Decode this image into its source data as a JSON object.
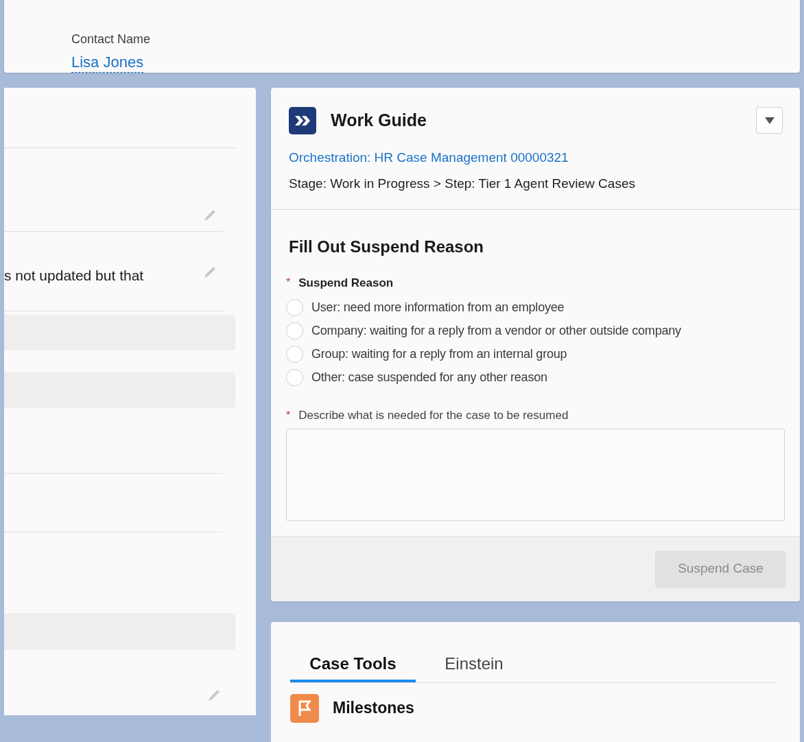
{
  "record_header": {
    "fields": [
      {
        "label": "Contact Name",
        "value": "Lisa Jones"
      }
    ]
  },
  "details_panel": {
    "partial_text": "s not updated but that"
  },
  "work_guide": {
    "title": "Work Guide",
    "orchestration_link": "Orchestration: HR Case Management 00000321",
    "stage": "Stage: Work in Progress > Step: Tier 1 Agent Review Cases",
    "form": {
      "title": "Fill Out Suspend Reason",
      "reason": {
        "label": "Suspend Reason",
        "required": true,
        "required_mark": "*",
        "options": [
          {
            "label": "User: need more information from an employee",
            "selected": false
          },
          {
            "label": "Company: waiting for a reply from a vendor or other outside company",
            "selected": false
          },
          {
            "label": "Group: waiting for a reply from an internal group",
            "selected": false
          },
          {
            "label": "Other: case suspended for any other reason",
            "selected": false
          }
        ]
      },
      "description": {
        "label": "Describe what is needed for the case to be resumed",
        "required": true,
        "required_mark": "*"
      }
    },
    "button": {
      "label": "Suspend Case",
      "disabled": true
    }
  },
  "case_tools": {
    "tabs": [
      {
        "label": "Case Tools",
        "selected": true
      },
      {
        "label": "Einstein",
        "selected": false
      }
    ],
    "section": {
      "title": "Milestones"
    }
  }
}
